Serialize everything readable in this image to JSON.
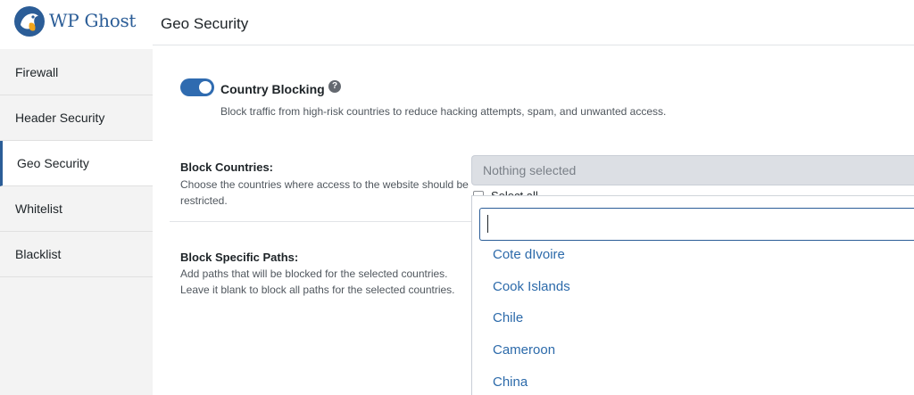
{
  "brand": {
    "name": "WP Ghost",
    "logo_icon": "ghost-bird-logo-icon"
  },
  "header": {
    "title": "Geo Security"
  },
  "sidebar": {
    "items": [
      {
        "label": "Firewall",
        "active": false
      },
      {
        "label": "Header Security",
        "active": false
      },
      {
        "label": "Geo Security",
        "active": true
      },
      {
        "label": "Whitelist",
        "active": false
      },
      {
        "label": "Blacklist",
        "active": false
      }
    ]
  },
  "country_blocking": {
    "enabled": true,
    "title": "Country Blocking",
    "help_icon": "question-circle-icon",
    "description": "Block traffic from high-risk countries to reduce hacking attempts, spam, and unwanted access."
  },
  "block_countries": {
    "label": "Block Countries:",
    "help": "Choose the countries where access to the website should be restricted.",
    "select_value": "Nothing selected",
    "select_all_label": "Select all",
    "search_value": "",
    "options": [
      "Cote dIvoire",
      "Cook Islands",
      "Chile",
      "Cameroon",
      "China"
    ]
  },
  "block_paths": {
    "label": "Block Specific Paths:",
    "help": "Add paths that will be blocked for the selected countries. Leave it blank to block all paths for the selected countries."
  },
  "colors": {
    "accent": "#2f6bb0",
    "link": "#2c6aaa",
    "brand": "#2b5d97"
  }
}
